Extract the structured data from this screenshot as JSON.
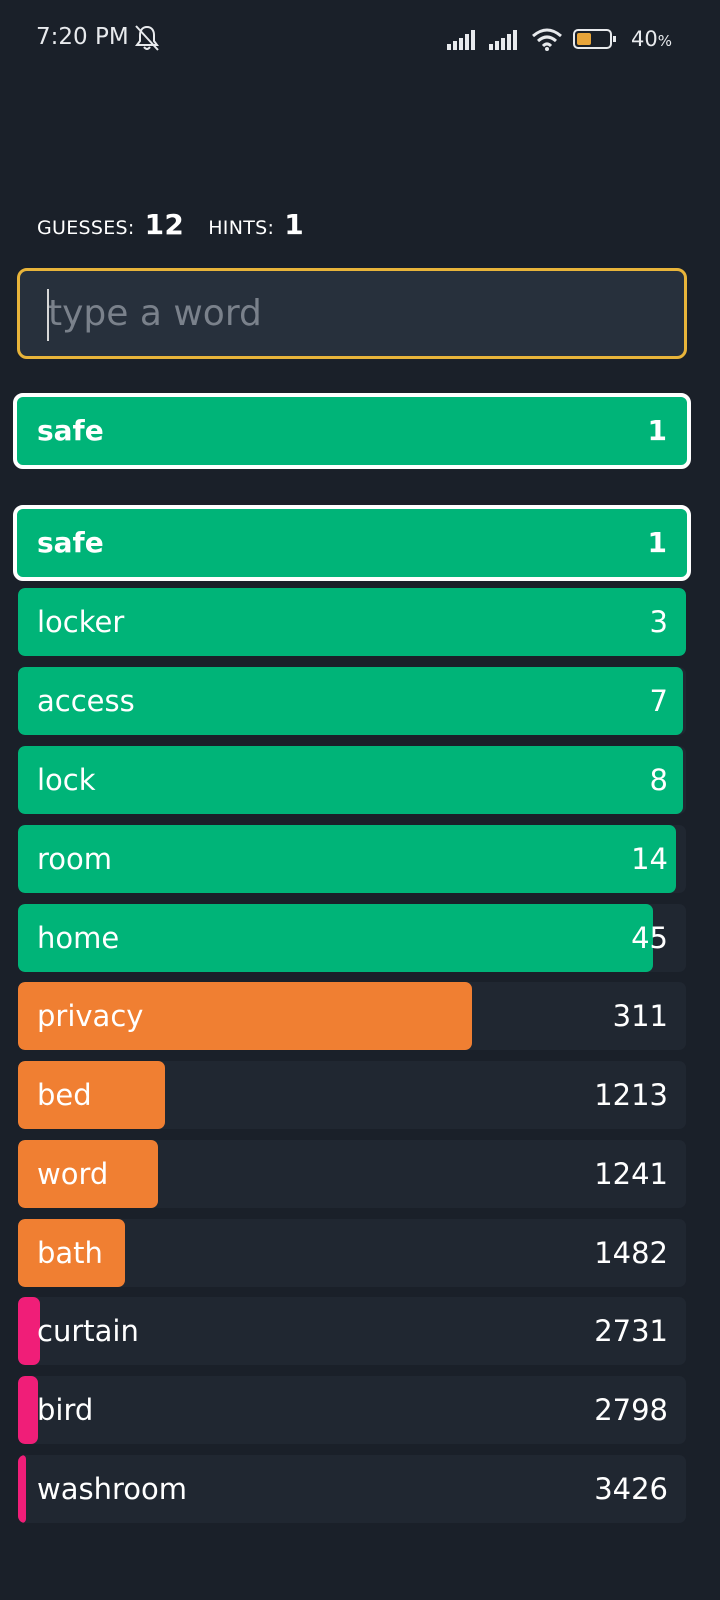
{
  "status_bar": {
    "time": "7:20 PM",
    "battery_percent": "40",
    "battery_suffix": "%",
    "icons": [
      "bell-off-icon",
      "signal-icon",
      "signal-icon",
      "wifi-icon",
      "battery-icon"
    ]
  },
  "counters": {
    "guesses_label": "GUESSES:",
    "guesses_value": "12",
    "hints_label": "HINTS:",
    "hints_value": "1"
  },
  "input": {
    "placeholder": "type a word",
    "value": ""
  },
  "colors": {
    "green": "#00b478",
    "orange": "#f07f32",
    "pink": "#f01e78",
    "input_border": "#e8b43a",
    "row_bg": "#202731"
  },
  "last_guess": {
    "word": "safe",
    "rank": "1",
    "fill_fraction": 1.0,
    "color": "green"
  },
  "guesses": [
    {
      "word": "safe",
      "rank": "1",
      "fill_fraction": 1.0,
      "color": "green",
      "highlight": true
    },
    {
      "word": "locker",
      "rank": "3",
      "fill_fraction": 1.0,
      "color": "green"
    },
    {
      "word": "access",
      "rank": "7",
      "fill_fraction": 0.995,
      "color": "green"
    },
    {
      "word": "lock",
      "rank": "8",
      "fill_fraction": 0.995,
      "color": "green"
    },
    {
      "word": "room",
      "rank": "14",
      "fill_fraction": 0.985,
      "color": "green"
    },
    {
      "word": "home",
      "rank": "45",
      "fill_fraction": 0.95,
      "color": "green"
    },
    {
      "word": "privacy",
      "rank": "311",
      "fill_fraction": 0.68,
      "color": "orange"
    },
    {
      "word": "bed",
      "rank": "1213",
      "fill_fraction": 0.22,
      "color": "orange"
    },
    {
      "word": "word",
      "rank": "1241",
      "fill_fraction": 0.21,
      "color": "orange"
    },
    {
      "word": "bath",
      "rank": "1482",
      "fill_fraction": 0.16,
      "color": "orange"
    },
    {
      "word": "curtain",
      "rank": "2731",
      "fill_fraction": 0.033,
      "color": "pink"
    },
    {
      "word": "bird",
      "rank": "2798",
      "fill_fraction": 0.03,
      "color": "pink"
    },
    {
      "word": "washroom",
      "rank": "3426",
      "fill_fraction": 0.012,
      "color": "pink"
    }
  ]
}
